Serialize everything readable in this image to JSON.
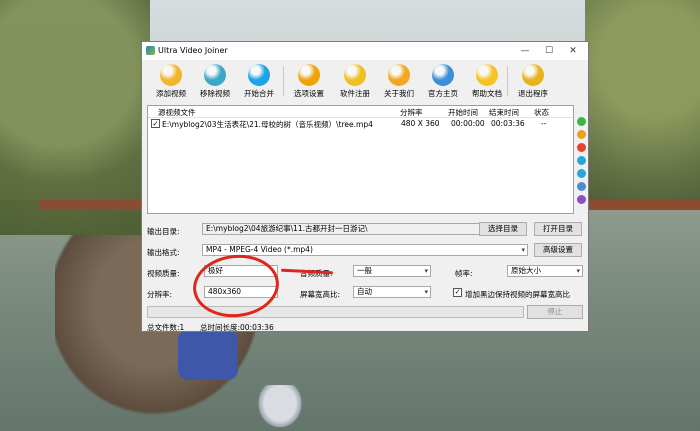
{
  "window": {
    "title": "Ultra Video Joiner",
    "controls": {
      "minimize": "—",
      "maximize": "☐",
      "close": "✕"
    }
  },
  "toolbar": {
    "buttons": [
      {
        "label": "添加视频",
        "icon": "add-video-icon",
        "color": "#f2b52c"
      },
      {
        "label": "移除视频",
        "icon": "trash-icon",
        "color": "#3aa9c7"
      },
      {
        "label": "开始合并",
        "icon": "play-icon",
        "color": "#1aa3e8"
      },
      {
        "label": "选项设置",
        "icon": "gear-icon",
        "color": "#f0a20b"
      },
      {
        "label": "软件注册",
        "icon": "lock-key-icon",
        "color": "#f0c01e"
      },
      {
        "label": "关于我们",
        "icon": "person-icon",
        "color": "#f2a81e"
      },
      {
        "label": "官方主页",
        "icon": "home-globe-icon",
        "color": "#3a8fd8"
      },
      {
        "label": "帮助文档",
        "icon": "help-icon",
        "color": "#f5c324"
      },
      {
        "label": "退出程序",
        "icon": "exit-icon",
        "color": "#e8b21c"
      }
    ]
  },
  "list": {
    "headers": {
      "file": "源视频文件",
      "resolution": "分辨率",
      "start": "开始时间",
      "end": "结束时间",
      "status": "状态"
    },
    "rows": [
      {
        "checked": "✓",
        "file": "E:\\myblog2\\03生活表花\\21.母校的树（音乐视频）\\tree.mp4",
        "resolution": "480 X 360",
        "start": "00:00:00",
        "end": "00:03:36",
        "status": "--"
      }
    ]
  },
  "side_icons": [
    {
      "name": "plus-icon",
      "color": "#3cb54a"
    },
    {
      "name": "minus-icon",
      "color": "#e8a21c"
    },
    {
      "name": "delete-icon",
      "color": "#e2442f"
    },
    {
      "name": "move-up-icon",
      "color": "#27a7d9"
    },
    {
      "name": "move-down-icon",
      "color": "#27a7d9"
    },
    {
      "name": "refresh-icon",
      "color": "#4a8fd0"
    },
    {
      "name": "info-icon",
      "color": "#8a4fc8"
    }
  ],
  "output": {
    "dir_label": "输出目录:",
    "dir_value": "E:\\myblog2\\04旅游纪事\\11.古都开封一日游记\\",
    "choose_dir": "选择目录",
    "open_dir": "打开目录",
    "format_label": "输出格式:",
    "format_value": "MP4 - MPEG-4 Video (*.mp4)",
    "advanced": "高级设置"
  },
  "settings": {
    "video_quality_label": "视频质量:",
    "video_quality_value": "极好",
    "resolution_label": "分辨率:",
    "resolution_value": "480x360",
    "audio_quality_label": "音频质量:",
    "audio_quality_value": "一般",
    "aspect_label": "屏幕宽高比:",
    "aspect_value": "自动",
    "framerate_label": "帧率:",
    "framerate_value": "原始大小",
    "keep_aspect_checked": "✓",
    "keep_aspect_label": "增加黑边保持视频的屏幕宽高比"
  },
  "progress": {
    "value": 0
  },
  "stop_button": "停止",
  "status": {
    "total_files": "总文件数:1",
    "total_duration": "总时间长度:00:03:36"
  },
  "annotation_color": "#e0251b"
}
